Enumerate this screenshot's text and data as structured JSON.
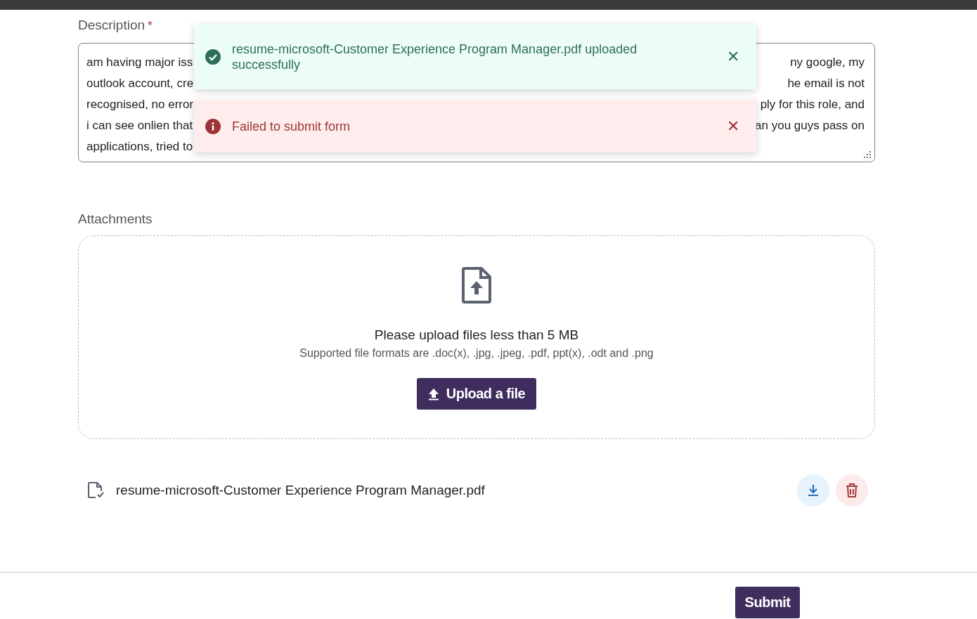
{
  "description": {
    "label": "Description",
    "required_mark": "*",
    "lines": [
      {
        "left": "am having major iss",
        "right": "ny google, my"
      },
      {
        "left": "outlook account, cre",
        "right": "he email is not"
      },
      {
        "left": "recognised, no error",
        "right": "ply for this role, and"
      },
      {
        "left": "i can see onlien that",
        "right": "an you guys pass on"
      },
      {
        "left": "applications, tried to"
      }
    ]
  },
  "toasts": [
    {
      "kind": "success",
      "message": "resume-microsoft-Customer Experience Program Manager.pdf uploaded successfully",
      "close": "✕"
    },
    {
      "kind": "error",
      "message": "Failed to submit form",
      "close": "✕"
    }
  ],
  "attachments": {
    "label": "Attachments",
    "hint": "Please upload files less than 5 MB",
    "formats": "Supported file formats are .doc(x), .jpg, .jpeg, .pdf, ppt(x), .odt and .png",
    "upload_button": "Upload a file"
  },
  "files": [
    {
      "name": "resume-microsoft-Customer Experience Program Manager.pdf"
    }
  ],
  "submit_button": "Submit"
}
